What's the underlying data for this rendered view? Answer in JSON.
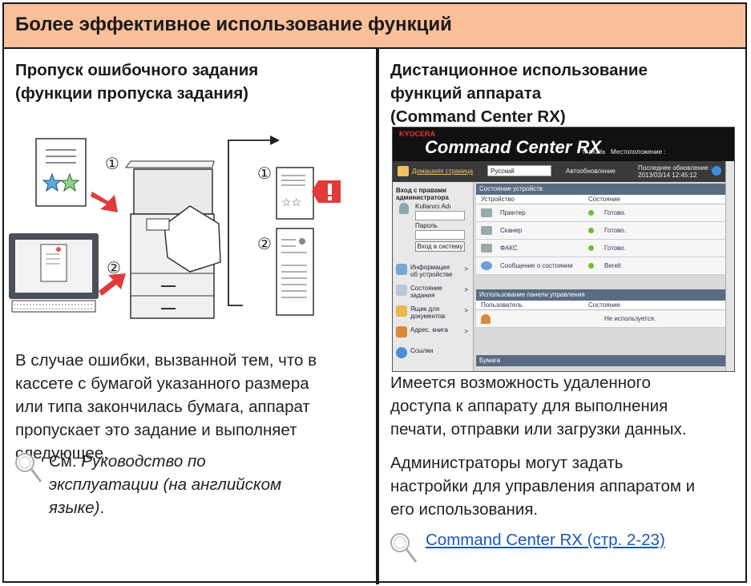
{
  "header": {
    "title": "Более эффективное использование функций"
  },
  "left": {
    "heading_line1": "Пропуск ошибочного задания",
    "heading_line2": "(функции пропуска задания)",
    "body_lines": [
      "В случае ошибки, вызванной тем, что в",
      "кассете с бумагой указанного размера",
      "или типа закончилась бумага, аппарат",
      "пропускает это задание и выполняет",
      "следующее."
    ],
    "ref_prefix": "См. ",
    "ref_line1_italic": "Руководство по",
    "ref_line2_italic": "эксплуатации (на английском",
    "ref_line3_italic": "языке)",
    "ref_suffix": ".",
    "marker1": "①",
    "marker2": "②",
    "marker3": "①",
    "marker4": "②"
  },
  "right": {
    "heading_line1": "Дистанционное использование",
    "heading_line2": "функций аппарата",
    "heading_line3": "(Command Center RX)",
    "body1_lines": [
      "Имеется возможность удаленного",
      "доступа к аппарату для выполнения",
      "печати, отправки или загрузки данных."
    ],
    "body2_lines": [
      "Администраторы могут задать",
      "настройки для управления аппаратом и",
      "его использования."
    ],
    "link": "Command Center RX (стр. 2-23)"
  },
  "cc": {
    "brand": "KYOCERA",
    "title": "Command Center RX",
    "taskalfa": "TASKalfa",
    "location": "Местоположение :",
    "home": "Домашняя страница",
    "language": "Русский",
    "auto_refresh": "Автообновление",
    "last_update_label": "Последнее обновление :",
    "last_update_value": "2013/03/14 12:45:12",
    "login": "Вход с правами администратора",
    "user": "Kullanıcı Adı",
    "password": "Пароль",
    "login_button": "Вход в систему",
    "menu": [
      "Информация об устройстве",
      "Состояние задания",
      "Ящик для документов",
      "Адрес. книга",
      "Ссылки"
    ],
    "panel1": "Состояние устройств",
    "col_device": "Устройство",
    "col_status": "Состояние",
    "devices": [
      {
        "name": "Принтер",
        "status": "Готово."
      },
      {
        "name": "Сканер",
        "status": "Готово."
      },
      {
        "name": "ФАКС",
        "status": "Готово."
      },
      {
        "name": "Сообщение о состоянии",
        "status": "Bereit"
      }
    ],
    "panel2": "Использование панели управления",
    "col_user": "Пользователь",
    "col_state": "Состояние",
    "panel_usage": "Не используется.",
    "panel3": "Бумага",
    "colors": {
      "green": "#6cbf2a",
      "header": "#fbbf9a",
      "link": "#1a56b8"
    }
  }
}
